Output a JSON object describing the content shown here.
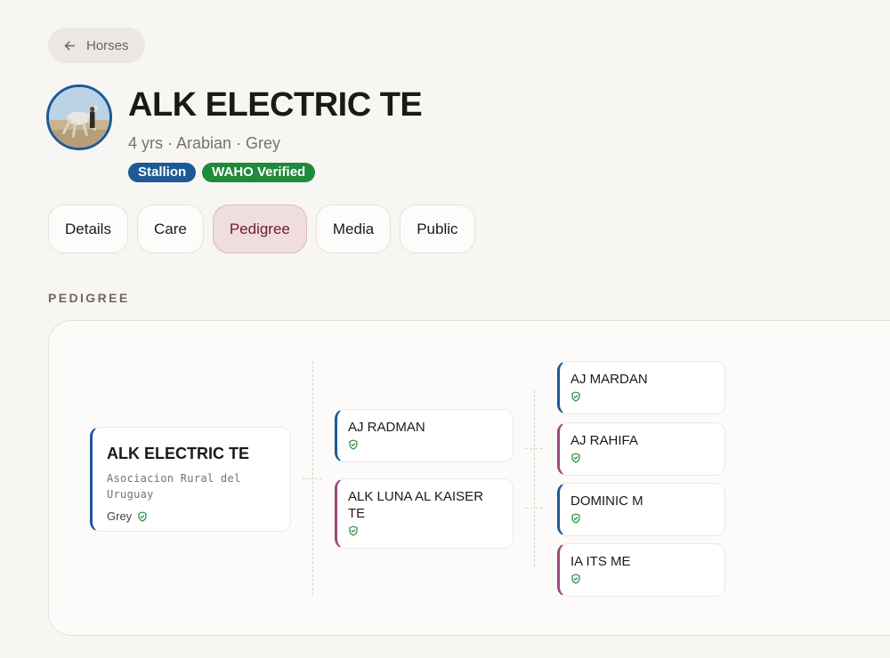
{
  "back": {
    "label": "Horses"
  },
  "horse": {
    "name": "ALK ELECTRIC TE",
    "subtitle": "4 yrs · Arabian · Grey",
    "badges": [
      {
        "label": "Stallion",
        "color": "#1b5a95"
      },
      {
        "label": "WAHO Verified",
        "color": "#1f8a3c"
      }
    ]
  },
  "tabs": [
    {
      "label": "Details",
      "active": false
    },
    {
      "label": "Care",
      "active": false
    },
    {
      "label": "Pedigree",
      "active": true
    },
    {
      "label": "Media",
      "active": false
    },
    {
      "label": "Public",
      "active": false
    }
  ],
  "section_label": "PEDIGREE",
  "pedigree": {
    "subject": {
      "name": "ALK ELECTRIC TE",
      "registry": "Asociacion Rural del Uruguay",
      "color": "Grey"
    },
    "sire": {
      "name": "AJ RADMAN"
    },
    "dam": {
      "name": "ALK LUNA AL KAISER TE"
    },
    "sire_sire": {
      "name": "AJ MARDAN"
    },
    "sire_dam": {
      "name": "AJ RAHIFA"
    },
    "dam_sire": {
      "name": "DOMINIC M"
    },
    "dam_dam": {
      "name": "IA ITS ME"
    }
  },
  "colors": {
    "male": "#1b5a95",
    "female": "#9a4a7a",
    "verified": "#1f8a3c",
    "active_tab": "#f0dde0"
  },
  "icons": {
    "back": "arrow-left-icon",
    "verified": "shield-check-icon"
  }
}
